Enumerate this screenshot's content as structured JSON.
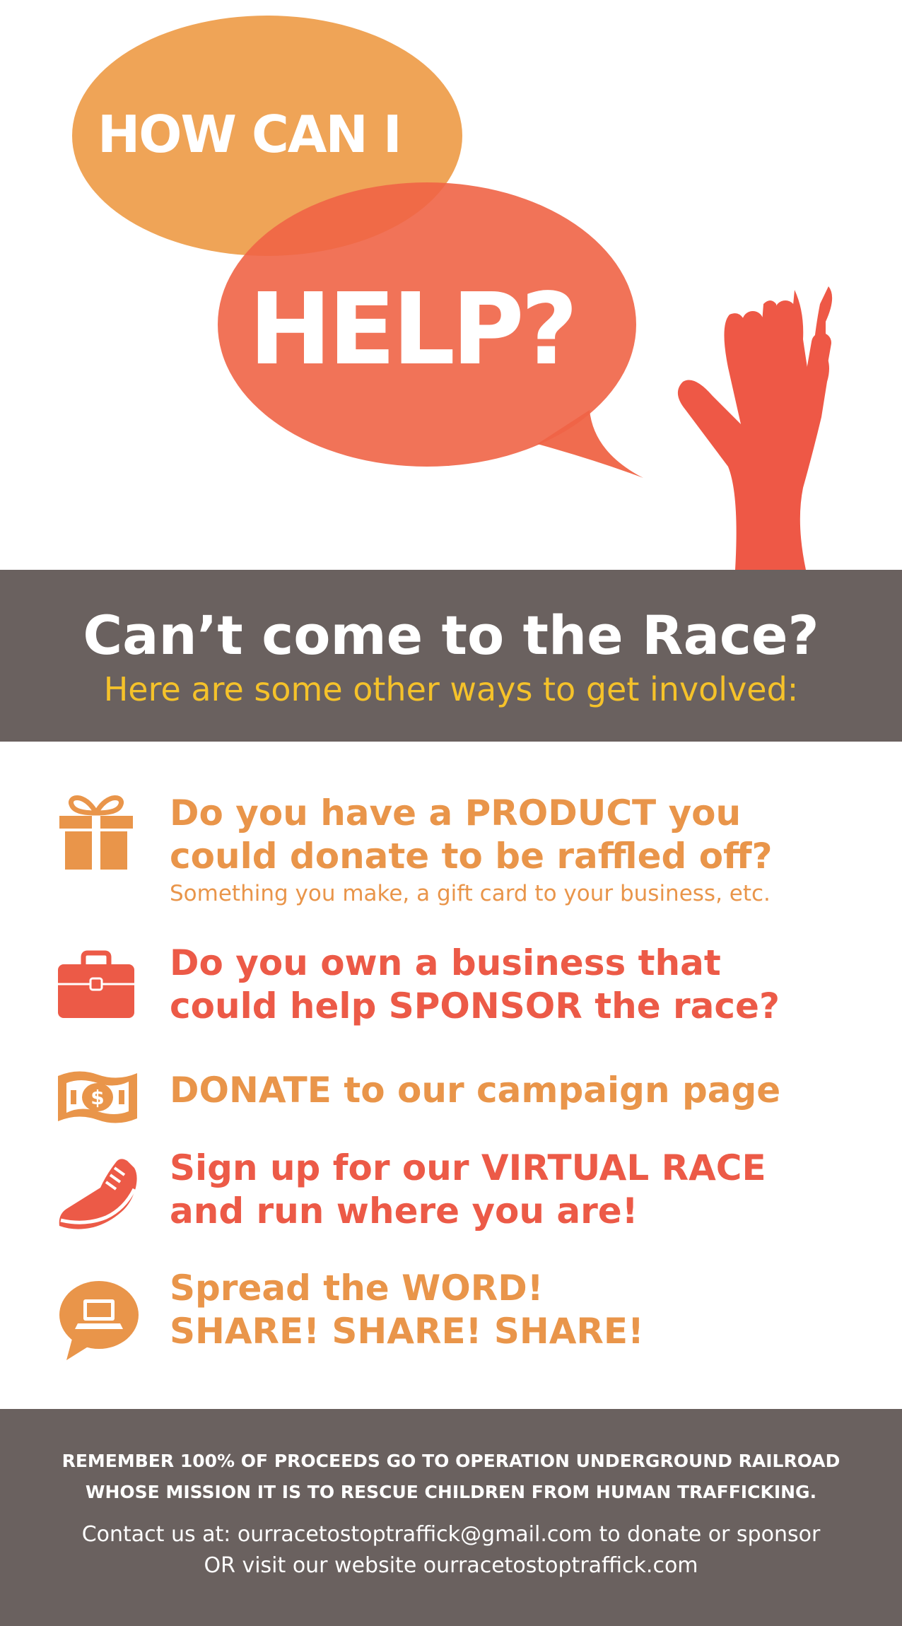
{
  "hero": {
    "line1": "HOW CAN I",
    "line2": "HELP?"
  },
  "band": {
    "title": "Can’t come to the Race?",
    "subtitle": "Here are some other ways to get involved:"
  },
  "ways": [
    {
      "icon": "gift-icon",
      "line1": "Do you have a PRODUCT you",
      "line2": "could donate to be raffled off?",
      "note": "Something you make, a gift card to your business, etc."
    },
    {
      "icon": "briefcase-icon",
      "line1": "Do you own a business that",
      "line2": "could help SPONSOR the race?"
    },
    {
      "icon": "money-icon",
      "line1": "DONATE to our campaign page"
    },
    {
      "icon": "running-shoe-icon",
      "line1": "Sign up for our VIRTUAL RACE",
      "line2": "and run where you are!"
    },
    {
      "icon": "laptop-chat-icon",
      "line1": "Spread the WORD!",
      "line2": "SHARE! SHARE! SHARE!"
    }
  ],
  "footer": {
    "line1": "REMEMBER 100% OF PROCEEDS GO TO OPERATION UNDERGROUND RAILROAD",
    "line2": "WHOSE MISSION IT IS TO RESCUE CHILDREN FROM HUMAN TRAFFICKING.",
    "line3": "Contact us at: ourracetostoptraffick@gmail.com to donate or sponsor",
    "line4": "OR visit our website ourracetostoptraffick.com"
  },
  "colors": {
    "orange": "#e9954a",
    "red": "#ec5a47",
    "band": "#6a615f",
    "yellow": "#f5c22a"
  }
}
